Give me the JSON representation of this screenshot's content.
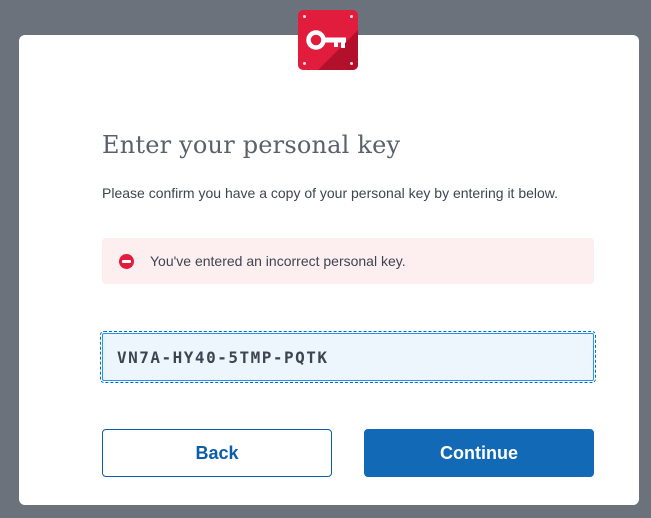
{
  "dialog": {
    "title": "Enter your personal key",
    "subtitle": "Please confirm you have a copy of your personal key by entering it below.",
    "icon": "personal-key-icon"
  },
  "error": {
    "icon": "error-minus-circle-icon",
    "message": "You've entered an incorrect personal key."
  },
  "key_input": {
    "value": "VN7A-HY40-5TMP-PQTK"
  },
  "buttons": {
    "back_label": "Back",
    "continue_label": "Continue"
  },
  "colors": {
    "overlay": "#6b727b",
    "badge": "#e21c3d",
    "error_bg": "#fdeef0",
    "primary": "#1269b6"
  }
}
